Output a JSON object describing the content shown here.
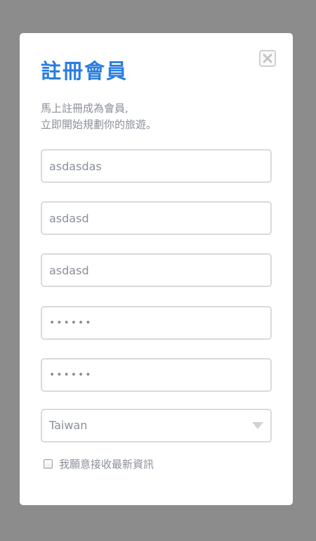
{
  "modal": {
    "title": "註冊會員",
    "subtitle_line1": "馬上註冊成為會員,",
    "subtitle_line2": "立即開始規劃你的旅遊。",
    "close_icon": "close-icon"
  },
  "form": {
    "field1_value": "asdasdas",
    "field2_value": "asdasd",
    "field3_value": "asdasd",
    "password_value": "••••••",
    "password_confirm_value": "••••••",
    "country_value": "Taiwan",
    "newsletter_label": "我願意接收最新資訊",
    "newsletter_checked": false
  },
  "colors": {
    "accent": "#2a7de1",
    "backdrop": "#8c8c8c",
    "text_muted": "#8a8f99",
    "border": "#dadada"
  }
}
